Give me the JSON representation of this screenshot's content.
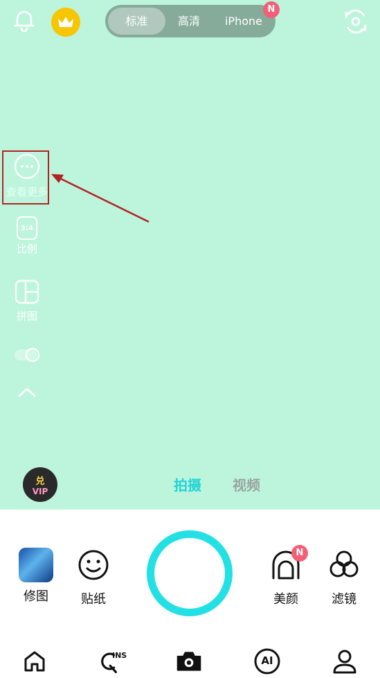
{
  "quality": {
    "options": [
      "标准",
      "高清",
      "iPhone"
    ],
    "selected": "标准",
    "new_badge": "N"
  },
  "side_menu": {
    "more_label": "查看更多",
    "ratio_value": "3:4",
    "ratio_label": "比例",
    "collage_label": "拼图"
  },
  "modes": {
    "photo": "拍摄",
    "video": "视频"
  },
  "vip": {
    "line1": "兑",
    "line2": "VIP"
  },
  "tools": {
    "edit": "修图",
    "sticker": "贴纸",
    "beauty": "美颜",
    "beauty_badge": "N",
    "filter": "滤镜"
  },
  "bottom_nav": {
    "ins_text": "INS",
    "ai_text": "AI"
  },
  "colors": {
    "camera_bg": "#bdf5dc",
    "accent_cyan": "#22e0e3",
    "badge_pink": "#f45f78",
    "crown_yellow": "#f7c600",
    "annotation_red": "#b22222"
  }
}
